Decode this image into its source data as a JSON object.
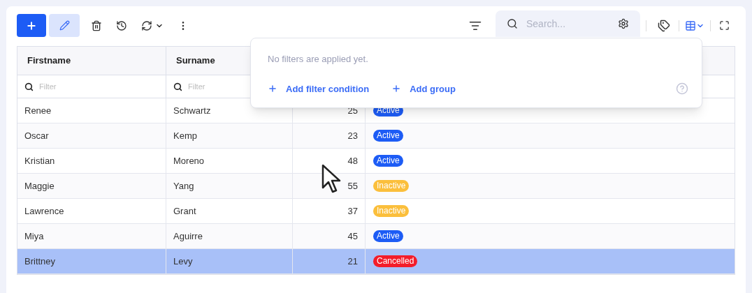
{
  "toolbar": {
    "search": {
      "placeholder": "Search..."
    }
  },
  "table": {
    "columns": [
      {
        "label": "Firstname",
        "filter_placeholder": "Filter"
      },
      {
        "label": "Surname",
        "filter_placeholder": "Filter"
      }
    ],
    "rows": [
      {
        "firstname": "Renee",
        "surname": "Schwartz",
        "age": "25",
        "status": {
          "text": "Active",
          "color": "#1d5cf5"
        },
        "selected": false
      },
      {
        "firstname": "Oscar",
        "surname": "Kemp",
        "age": "23",
        "status": {
          "text": "Active",
          "color": "#1d5cf5"
        },
        "selected": false
      },
      {
        "firstname": "Kristian",
        "surname": "Moreno",
        "age": "48",
        "status": {
          "text": "Active",
          "color": "#1d5cf5"
        },
        "selected": false
      },
      {
        "firstname": "Maggie",
        "surname": "Yang",
        "age": "55",
        "status": {
          "text": "Inactive",
          "color": "#fbbf3c"
        },
        "selected": false
      },
      {
        "firstname": "Lawrence",
        "surname": "Grant",
        "age": "37",
        "status": {
          "text": "Inactive",
          "color": "#fbbf3c"
        },
        "selected": false
      },
      {
        "firstname": "Miya",
        "surname": "Aguirre",
        "age": "45",
        "status": {
          "text": "Active",
          "color": "#1d5cf5"
        },
        "selected": false
      },
      {
        "firstname": "Brittney",
        "surname": "Levy",
        "age": "21",
        "status": {
          "text": "Cancelled",
          "color": "#f31d2a"
        },
        "selected": true
      }
    ]
  },
  "filter_popup": {
    "message": "No filters are applied yet.",
    "actions": [
      "Add filter condition",
      "Add group"
    ]
  }
}
